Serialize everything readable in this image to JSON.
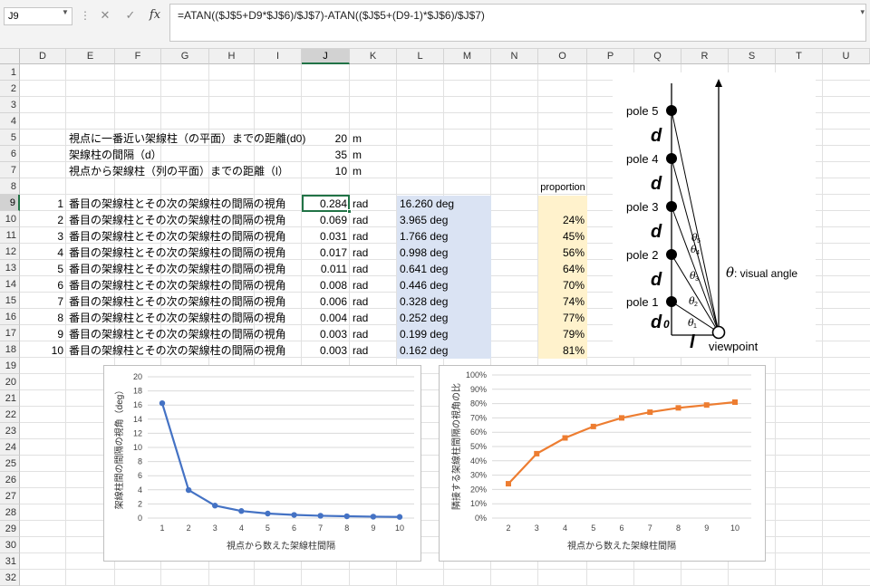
{
  "formula_bar": {
    "name_box": "J9",
    "cancel_icon": "✕",
    "enter_icon": "✓",
    "fx_label": "fx",
    "formula": "=ATAN(($J$5+D9*$J$6)/$J$7)-ATAN(($J$5+(D9-1)*$J$6)/$J$7)"
  },
  "columns": [
    "D",
    "E",
    "F",
    "G",
    "H",
    "I",
    "J",
    "K",
    "L",
    "M",
    "N",
    "O",
    "P",
    "Q",
    "R",
    "S",
    "T",
    "U"
  ],
  "selected_column": "J",
  "rows": [
    "1",
    "2",
    "3",
    "4",
    "5",
    "6",
    "7",
    "8",
    "9",
    "10",
    "11",
    "12",
    "13",
    "14",
    "15",
    "16",
    "17",
    "18",
    "19",
    "20",
    "21",
    "22",
    "23",
    "24",
    "25",
    "26",
    "27",
    "28",
    "29",
    "30",
    "31",
    "32"
  ],
  "selected_row": "9",
  "params": [
    {
      "label": "視点に一番近い架線柱（の平面）までの距離(d0)",
      "value": "20",
      "unit": "m"
    },
    {
      "label": "架線柱の間隔（d）",
      "value": "35",
      "unit": "m"
    },
    {
      "label": "視点から架線柱（列の平面）までの距離（l）",
      "value": "10",
      "unit": "m"
    }
  ],
  "proportion_header": "proportion",
  "table": [
    {
      "n": "1",
      "label": "番目の架線柱とその次の架線柱の間隔の視角",
      "rad": "0.284",
      "unit": "rad",
      "deg": "16.260 deg",
      "prop": ""
    },
    {
      "n": "2",
      "label": "番目の架線柱とその次の架線柱の間隔の視角",
      "rad": "0.069",
      "unit": "rad",
      "deg": "3.965 deg",
      "prop": "24%"
    },
    {
      "n": "3",
      "label": "番目の架線柱とその次の架線柱の間隔の視角",
      "rad": "0.031",
      "unit": "rad",
      "deg": "1.766 deg",
      "prop": "45%"
    },
    {
      "n": "4",
      "label": "番目の架線柱とその次の架線柱の間隔の視角",
      "rad": "0.017",
      "unit": "rad",
      "deg": "0.998 deg",
      "prop": "56%"
    },
    {
      "n": "5",
      "label": "番目の架線柱とその次の架線柱の間隔の視角",
      "rad": "0.011",
      "unit": "rad",
      "deg": "0.641 deg",
      "prop": "64%"
    },
    {
      "n": "6",
      "label": "番目の架線柱とその次の架線柱の間隔の視角",
      "rad": "0.008",
      "unit": "rad",
      "deg": "0.446 deg",
      "prop": "70%"
    },
    {
      "n": "7",
      "label": "番目の架線柱とその次の架線柱の間隔の視角",
      "rad": "0.006",
      "unit": "rad",
      "deg": "0.328 deg",
      "prop": "74%"
    },
    {
      "n": "8",
      "label": "番目の架線柱とその次の架線柱の間隔の視角",
      "rad": "0.004",
      "unit": "rad",
      "deg": "0.252 deg",
      "prop": "77%"
    },
    {
      "n": "9",
      "label": "番目の架線柱とその次の架線柱の間隔の視角",
      "rad": "0.003",
      "unit": "rad",
      "deg": "0.199 deg",
      "prop": "79%"
    },
    {
      "n": "10",
      "label": "番目の架線柱とその次の架線柱の間隔の視角",
      "rad": "0.003",
      "unit": "rad",
      "deg": "0.162 deg",
      "prop": "81%"
    }
  ],
  "diagram": {
    "poles": [
      "pole 5",
      "pole 4",
      "pole 3",
      "pole 2",
      "pole 1"
    ],
    "d_label": "d",
    "d0_label": "d",
    "d0_sub": "0",
    "l_label": "l",
    "viewpoint": "viewpoint",
    "theta_symbol": "θ",
    "visual_angle": ": visual angle",
    "theta_subs": [
      "1",
      "2",
      "3",
      "4",
      "5"
    ]
  },
  "chart_data": [
    {
      "type": "line",
      "x": [
        1,
        2,
        3,
        4,
        5,
        6,
        7,
        8,
        9,
        10
      ],
      "xticks": [
        "1",
        "2",
        "3",
        "4",
        "5",
        "6",
        "7",
        "8",
        "9",
        "10"
      ],
      "series": [
        {
          "values": [
            16.26,
            3.965,
            1.766,
            0.998,
            0.641,
            0.446,
            0.328,
            0.252,
            0.199,
            0.162
          ],
          "color": "#4472c4"
        }
      ],
      "xlabel": "視点から数えた架線柱間隔",
      "ylabel": "架線柱間の間隔の視角（deg）",
      "ylim": [
        0,
        20
      ],
      "yticks": [
        "0",
        "2",
        "4",
        "6",
        "8",
        "10",
        "12",
        "14",
        "16",
        "18",
        "20"
      ],
      "grid": true
    },
    {
      "type": "line",
      "x": [
        2,
        3,
        4,
        5,
        6,
        7,
        8,
        9,
        10
      ],
      "xticks": [
        "2",
        "3",
        "4",
        "5",
        "6",
        "7",
        "8",
        "9",
        "10"
      ],
      "series": [
        {
          "values": [
            0.24,
            0.45,
            0.56,
            0.64,
            0.7,
            0.74,
            0.77,
            0.79,
            0.81
          ],
          "color": "#ed7d31"
        }
      ],
      "xlabel": "視点から数えた架線柱間隔",
      "ylabel": "隣接する架線柱間隔の視角の比",
      "ylim": [
        0,
        1
      ],
      "yticks": [
        "0%",
        "10%",
        "20%",
        "30%",
        "40%",
        "50%",
        "60%",
        "70%",
        "80%",
        "90%",
        "100%"
      ],
      "grid": true
    }
  ]
}
